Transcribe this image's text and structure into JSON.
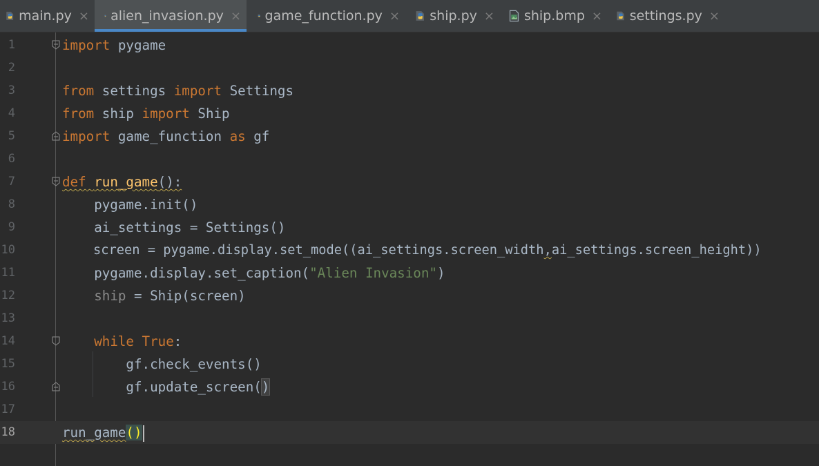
{
  "tabs": [
    {
      "label": "main.py",
      "icon": "python-file-icon",
      "active": false
    },
    {
      "label": "alien_invasion.py",
      "icon": "python-file-icon",
      "active": true
    },
    {
      "label": "game_function.py",
      "icon": "python-file-icon",
      "active": false
    },
    {
      "label": "ship.py",
      "icon": "python-file-icon",
      "active": false
    },
    {
      "label": "ship.bmp",
      "icon": "image-file-icon",
      "active": false
    },
    {
      "label": "settings.py",
      "icon": "python-file-icon",
      "active": false
    }
  ],
  "close_glyph": "×",
  "line_numbers": [
    "1",
    "2",
    "3",
    "4",
    "5",
    "6",
    "7",
    "8",
    "9",
    "10",
    "11",
    "12",
    "13",
    "14",
    "15",
    "16",
    "17",
    "18"
  ],
  "code": {
    "l1": {
      "a": "import",
      "b": " pygame"
    },
    "l3": {
      "a": "from",
      "b": " settings ",
      "c": "import",
      "d": " Settings"
    },
    "l4": {
      "a": "from",
      "b": " ship ",
      "c": "import",
      "d": " Ship"
    },
    "l5": {
      "a": "import",
      "b": " game_function ",
      "c": "as",
      "d": " gf"
    },
    "l7": {
      "a": "def",
      "b": " ",
      "c": "run_game",
      "d": "():"
    },
    "l8": {
      "a": "    pygame.init()"
    },
    "l9": {
      "a": "    ai_settings = Settings()"
    },
    "l10": {
      "a": "    screen = pygame.display.set_mode((ai_settings.screen_width",
      "b": ",",
      "c": "ai_settings.screen_height))"
    },
    "l11": {
      "a": "    pygame.display.set_caption(",
      "b": "\"Alien Invasion\"",
      "c": ")"
    },
    "l12": {
      "a": "    ",
      "b": "ship",
      "c": " = Ship(screen)"
    },
    "l14": {
      "a": "    ",
      "b": "while",
      "c": " ",
      "d": "True",
      "e": ":"
    },
    "l15": {
      "a": "        gf.check_events()"
    },
    "l16": {
      "a": "        gf.update_screen(",
      "b": ")"
    },
    "l18": {
      "a": "run_game",
      "b": "()"
    }
  },
  "colors": {
    "background": "#2b2b2b",
    "keyword": "#cc7832",
    "function": "#ffc66d",
    "string": "#6a8759",
    "text": "#a9b7c6",
    "active_tab_underline": "#4a88c7"
  }
}
